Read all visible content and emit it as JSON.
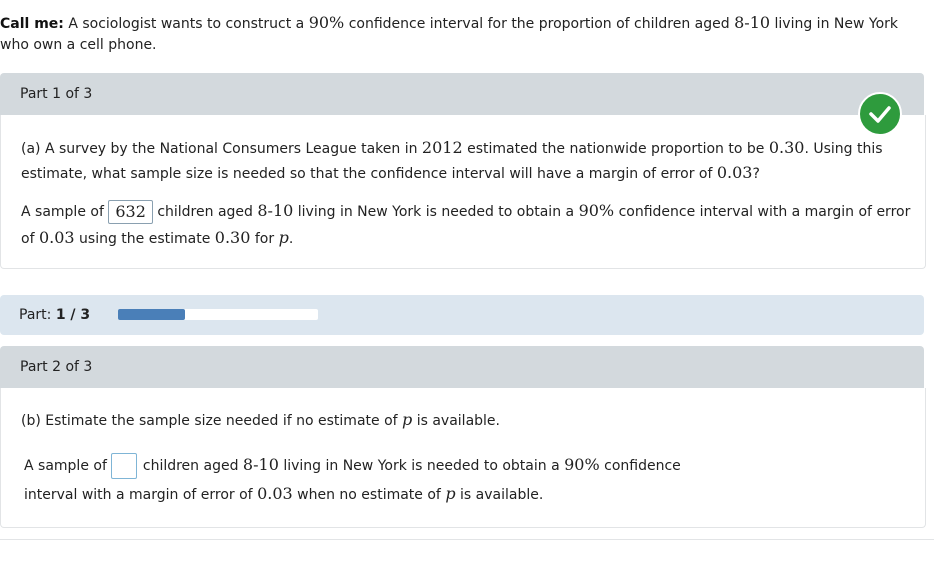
{
  "header": {
    "label": "Call me:",
    "t1": " A sociologist wants to construct a ",
    "conf": "90%",
    "t2": " confidence interval for the proportion of children aged ",
    "ages": "8-10",
    "t3": " living in New York who own a cell phone."
  },
  "part1": {
    "title": "Part 1 of 3",
    "status_icon": "check-circle-icon",
    "status_color": "#2e9b3d",
    "q_t1": "(a) A survey by the National Consumers League taken in ",
    "q_year": "2012",
    "q_t2": " estimated the nationwide proportion to be ",
    "q_p": "0.30",
    "q_t3": ". Using this estimate, what sample size is needed so that the confidence interval will have a margin of error of ",
    "q_moe": "0.03",
    "q_t4": "?",
    "a_t1": "A sample of ",
    "a_value": "632",
    "a_t2": " children aged ",
    "a_ages": "8-10",
    "a_t3": " living in New York is needed to obtain a ",
    "a_conf": "90%",
    "a_t4": " confidence interval with a margin of error of ",
    "a_moe": "0.03",
    "a_t5": " using the estimate ",
    "a_p": "0.30",
    "a_t6": " for ",
    "a_var": "p",
    "a_t7": "."
  },
  "progress": {
    "label": "Part: ",
    "value": "1 / 3",
    "fraction": 0.333,
    "color": "#4a7fb8"
  },
  "part2": {
    "title": "Part 2 of 3",
    "q_t1": "(b) Estimate the sample size needed if no estimate of ",
    "q_var": "p",
    "q_t2": " is available.",
    "a_t1": "A sample of",
    "a_value": "",
    "a_t2": "children aged ",
    "a_ages": "8-10",
    "a_t3": " living in New York is needed to obtain a ",
    "a_conf": "90%",
    "a_t4": " confidence interval with a margin of error of ",
    "a_moe": "0.03",
    "a_t5": " when no estimate of ",
    "a_var": "p",
    "a_t6": " is available."
  }
}
